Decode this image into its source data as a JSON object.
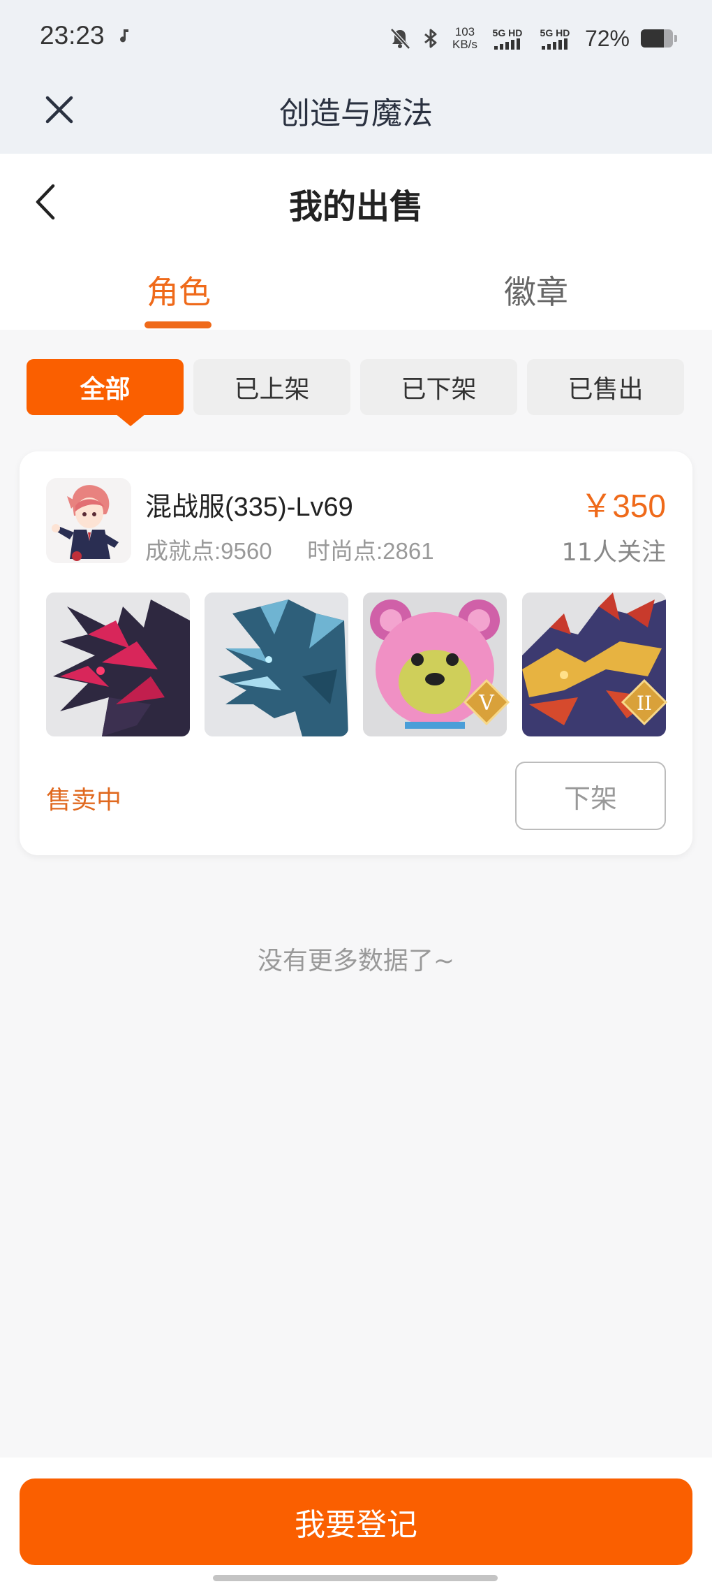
{
  "status_bar": {
    "time": "23:23",
    "net_speed_value": "103",
    "net_speed_unit": "KB/s",
    "sim1_label": "5G HD",
    "sim2_label": "5G HD",
    "battery_pct": "72%",
    "battery_level": 0.72
  },
  "webview": {
    "title": "创造与魔法"
  },
  "page": {
    "title": "我的出售"
  },
  "tabs": [
    {
      "label": "角色",
      "active": true
    },
    {
      "label": "徽章",
      "active": false
    }
  ],
  "filters": [
    {
      "label": "全部",
      "active": true
    },
    {
      "label": "已上架",
      "active": false
    },
    {
      "label": "已下架",
      "active": false
    },
    {
      "label": "已售出",
      "active": false
    }
  ],
  "listing": {
    "server": "混战服(335)-Lv69",
    "achievement": "成就点:9560",
    "fashion": "时尚点:2861",
    "price": "￥350",
    "followers": "11人关注",
    "thumbnails": [
      {
        "icon": "dark-dragon-mount",
        "badge": ""
      },
      {
        "icon": "ice-dragon-mount",
        "badge": ""
      },
      {
        "icon": "pink-bear-pet",
        "badge": "V"
      },
      {
        "icon": "fire-dragon-mount",
        "badge": "II"
      }
    ],
    "status": "售卖中",
    "delist_label": "下架"
  },
  "footer": {
    "no_more": "没有更多数据了~",
    "register_label": "我要登记"
  },
  "colors": {
    "accent": "#fa5f00",
    "accent_text": "#ef6a1a",
    "header_bg": "#eef1f5"
  }
}
